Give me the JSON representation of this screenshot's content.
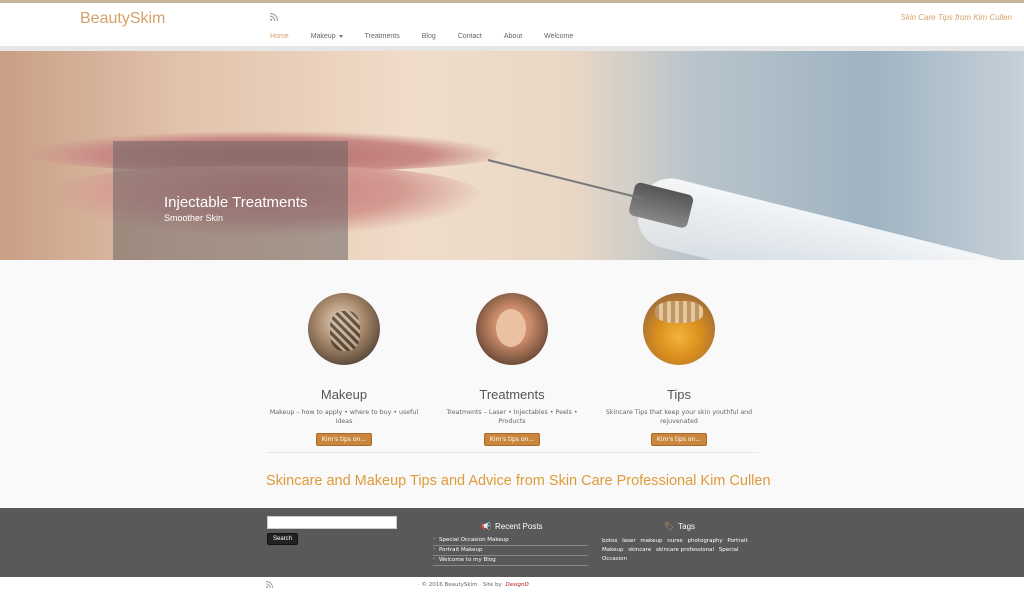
{
  "brand": "BeautySkim",
  "tagline": "Skin Care Tips from Kim Cullen",
  "nav": [
    {
      "label": "Home"
    },
    {
      "label": "Makeup"
    },
    {
      "label": "Treatments"
    },
    {
      "label": "Blog"
    },
    {
      "label": "Contact"
    },
    {
      "label": "About"
    },
    {
      "label": "Welcome"
    }
  ],
  "hero": {
    "title": "Injectable Treatments",
    "subtitle": "Smoother Skin"
  },
  "features": [
    {
      "title": "Makeup",
      "text": "Makeup – how to apply • where to buy • useful ideas",
      "button": "Kim's tips on..."
    },
    {
      "title": "Treatments",
      "text": "Treatments – Laser • Injectables • Peels • Products",
      "button": "Kim's tips on..."
    },
    {
      "title": "Tips",
      "text": "Skincare Tips that keep your skin youthful and rejuvenated",
      "button": "Kim's tips on..."
    }
  ],
  "headline": "Skincare and Makeup Tips and Advice from Skin Care Professional Kim Cullen",
  "footer": {
    "search_button": "Search",
    "search_value": "",
    "recent_posts_title": "Recent Posts",
    "recent_posts": [
      "Special Occasion Makeup",
      "Portrait Makeup",
      "Welcome to my Blog"
    ],
    "tags_title": "Tags",
    "tags": [
      "botox",
      "laser",
      "makeup",
      "nurse",
      "photography",
      "Portrait Makeup",
      "skincare",
      "skincare professional",
      "Special Occasion"
    ]
  },
  "copyright": "· © 2016 BeautySkim · Site by",
  "site_by_logo": "DesignD",
  "colors": {
    "accent": "#d4a169",
    "button": "#c9873e",
    "footer_bg": "#595959",
    "headline": "#dd9b3a"
  },
  "icons": [
    "rss-icon",
    "megaphone-icon",
    "tag-icon",
    "caret-down-icon"
  ]
}
